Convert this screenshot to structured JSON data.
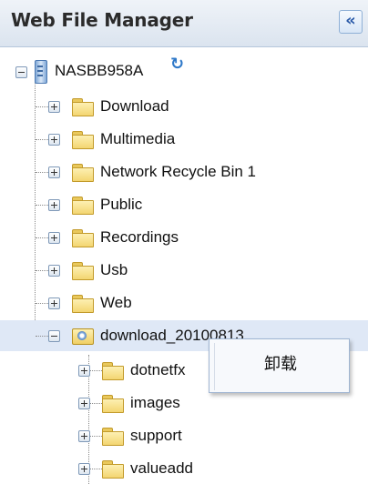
{
  "header": {
    "title": "Web File Manager",
    "collapse_glyph": "«"
  },
  "tree": {
    "root": {
      "label": "NASBB958A",
      "icon": "server-icon",
      "refresh_icon": "refresh-icon"
    },
    "folders": [
      {
        "label": "Download"
      },
      {
        "label": "Multimedia"
      },
      {
        "label": "Network Recycle Bin 1"
      },
      {
        "label": "Public"
      },
      {
        "label": "Recordings"
      },
      {
        "label": "Usb"
      },
      {
        "label": "Web"
      }
    ],
    "expanded_folder": {
      "label": "download_20100813",
      "icon": "open-disc-folder-icon",
      "children": [
        {
          "label": "dotnetfx"
        },
        {
          "label": "images"
        },
        {
          "label": "support"
        },
        {
          "label": "valueadd"
        }
      ]
    }
  },
  "context_menu": {
    "items": [
      {
        "label": "卸载"
      }
    ]
  },
  "colors": {
    "header_bg": "#dbe4ef",
    "selected_row": "#dfe8f6",
    "folder": "#f3d571",
    "accent": "#2a5aa8"
  }
}
